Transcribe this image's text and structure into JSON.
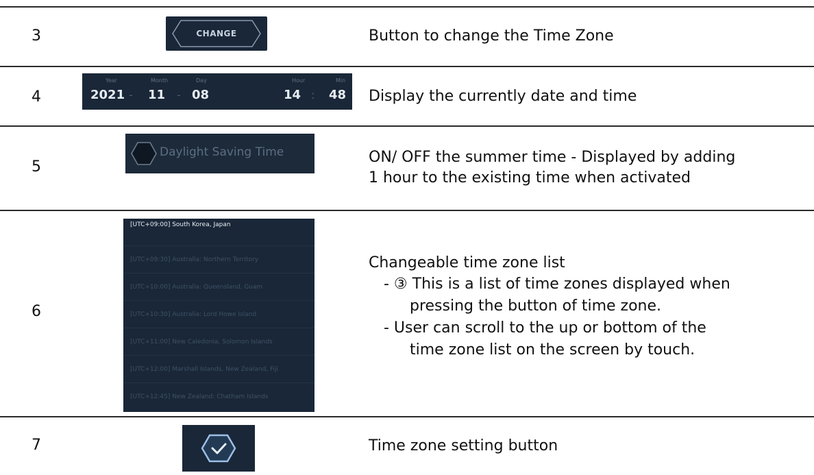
{
  "rows": [
    {
      "number": "3",
      "description": "Button to change the Time Zone",
      "change_button_label": "CHANGE"
    },
    {
      "number": "4",
      "description": "Display the currently date and time",
      "datetime": {
        "labels": {
          "year": "Year",
          "month": "Month",
          "day": "Day",
          "hour": "Hour",
          "min": "Min"
        },
        "year": "2021",
        "month": "11",
        "day": "08",
        "hour": "14",
        "min": "48",
        "date_separator": "-",
        "time_separator": ":"
      }
    },
    {
      "number": "5",
      "description_lines": [
        "ON/ OFF the summer time - Displayed by adding",
        "1 hour to the existing time when activated"
      ],
      "toggle_label": "Daylight Saving Time"
    },
    {
      "number": "6",
      "description_lines": [
        "Changeable time zone list",
        "- ③ This is a list of time zones displayed when",
        "pressing the button of time zone.",
        "- User can scroll to the up or bottom of the",
        "time zone list on the screen by touch."
      ],
      "timezones": [
        "[UTC+09:00] South Korea, Japan",
        "[UTC+09:30] Australia: Northern Territory",
        "[UTC+10:00] Australia: Queensland, Guam",
        "[UTC+10:30] Australia: Lord Howe Island",
        "[UTC+11:00] New Caledonia, Solomon Islands",
        "[UTC+12:00] Marshall Islands, New Zealand, Fiji",
        "[UTC+12:45] New Zealand: Chatham Islands"
      ]
    },
    {
      "number": "7",
      "description": "Time zone setting button",
      "icon": "check-icon"
    }
  ],
  "colors": {
    "panel_bg": "#1a2738",
    "rule": "#2a2a2a",
    "accent": "#8fb3db"
  }
}
